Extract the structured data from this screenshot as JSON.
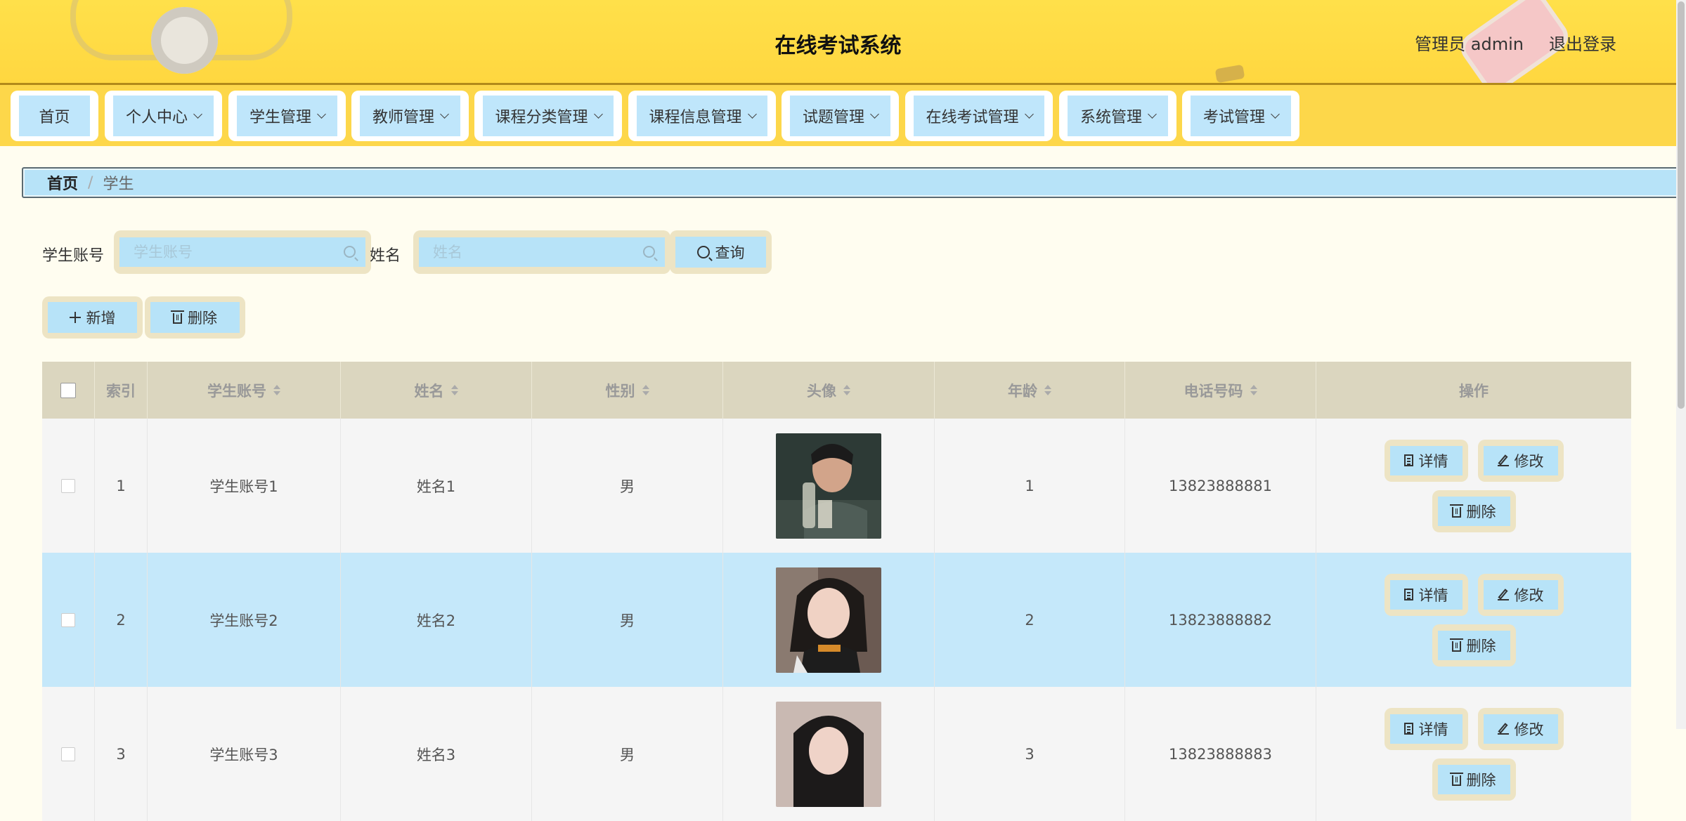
{
  "header": {
    "title": "在线考试系统",
    "user_label": "管理员 admin",
    "logout_label": "退出登录"
  },
  "nav": [
    {
      "label": "首页",
      "has_dropdown": false
    },
    {
      "label": "个人中心",
      "has_dropdown": true
    },
    {
      "label": "学生管理",
      "has_dropdown": true
    },
    {
      "label": "教师管理",
      "has_dropdown": true
    },
    {
      "label": "课程分类管理",
      "has_dropdown": true
    },
    {
      "label": "课程信息管理",
      "has_dropdown": true
    },
    {
      "label": "试题管理",
      "has_dropdown": true
    },
    {
      "label": "在线考试管理",
      "has_dropdown": true
    },
    {
      "label": "系统管理",
      "has_dropdown": true
    },
    {
      "label": "考试管理",
      "has_dropdown": true
    }
  ],
  "breadcrumb": {
    "home": "首页",
    "separator": "/",
    "current": "学生"
  },
  "search": {
    "account_label": "学生账号",
    "account_placeholder": "学生账号",
    "account_value": "",
    "name_label": "姓名",
    "name_placeholder": "姓名",
    "name_value": "",
    "query_label": "查询"
  },
  "actions": {
    "add_label": "新增",
    "delete_label": "删除"
  },
  "table": {
    "headers": {
      "index": "索引",
      "account": "学生账号",
      "name": "姓名",
      "gender": "性别",
      "avatar": "头像",
      "age": "年龄",
      "phone": "电话号码",
      "ops": "操作"
    },
    "rows": [
      {
        "index": "1",
        "account": "学生账号1",
        "name": "姓名1",
        "gender": "男",
        "age": "1",
        "phone": "13823888881"
      },
      {
        "index": "2",
        "account": "学生账号2",
        "name": "姓名2",
        "gender": "男",
        "age": "2",
        "phone": "13823888882"
      },
      {
        "index": "3",
        "account": "学生账号3",
        "name": "姓名3",
        "gender": "男",
        "age": "3",
        "phone": "13823888883"
      }
    ],
    "row_actions": {
      "detail": "详情",
      "edit": "修改",
      "delete": "删除"
    }
  },
  "colors": {
    "header_bg": "#ffd740",
    "button_bg": "#b7e3f8",
    "button_frame": "#ede4c4",
    "row_highlight": "#c5e8fa"
  }
}
